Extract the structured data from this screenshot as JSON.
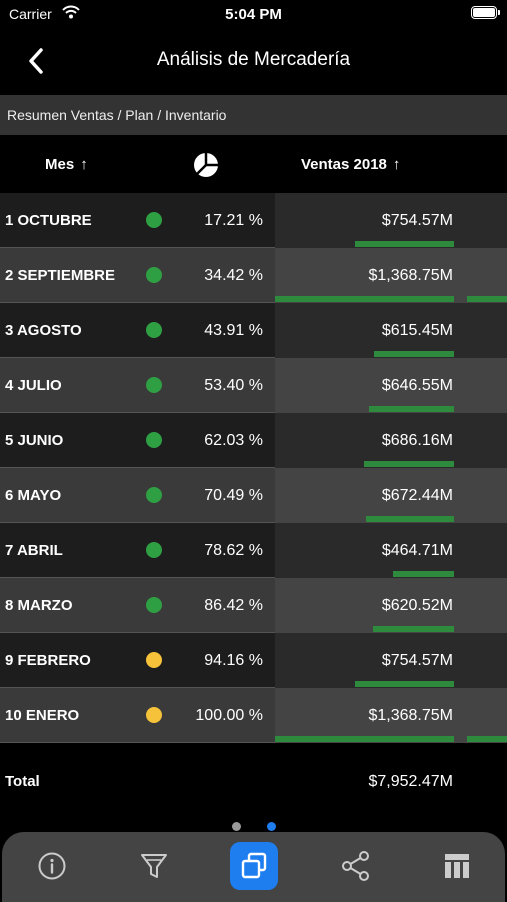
{
  "status_bar": {
    "carrier": "Carrier",
    "time": "5:04 PM"
  },
  "nav": {
    "title": "Análisis de Mercadería"
  },
  "subheader": "Resumen Ventas / Plan / Inventario",
  "columns": {
    "mes": "Mes",
    "ventas": "Ventas 2018",
    "sort_arrow": "↑"
  },
  "colors": {
    "green": "#2e8b3e",
    "dot_green": "#2ea043",
    "dot_yellow": "#f5c23a",
    "accent": "#1e7ef0"
  },
  "rows": [
    {
      "month": "1 OCTUBRE",
      "percent": "17.21 %",
      "sales": "$754.57M",
      "status": "green",
      "bar_value": 754.57
    },
    {
      "month": "2 SEPTIEMBRE",
      "percent": "34.42 %",
      "sales": "$1,368.75M",
      "status": "green",
      "bar_value": 1368.75
    },
    {
      "month": "3 AGOSTO",
      "percent": "43.91 %",
      "sales": "$615.45M",
      "status": "green",
      "bar_value": 615.45
    },
    {
      "month": "4 JULIO",
      "percent": "53.40 %",
      "sales": "$646.55M",
      "status": "green",
      "bar_value": 646.55
    },
    {
      "month": "5 JUNIO",
      "percent": "62.03 %",
      "sales": "$686.16M",
      "status": "green",
      "bar_value": 686.16
    },
    {
      "month": "6 MAYO",
      "percent": "70.49 %",
      "sales": "$672.44M",
      "status": "green",
      "bar_value": 672.44
    },
    {
      "month": "7 ABRIL",
      "percent": "78.62 %",
      "sales": "$464.71M",
      "status": "green",
      "bar_value": 464.71
    },
    {
      "month": "8 MARZO",
      "percent": "86.42 %",
      "sales": "$620.52M",
      "status": "green",
      "bar_value": 620.52
    },
    {
      "month": "9 FEBRERO",
      "percent": "94.16 %",
      "sales": "$754.57M",
      "status": "yellow",
      "bar_value": 754.57
    },
    {
      "month": "10 ENERO",
      "percent": "100.00 %",
      "sales": "$1,368.75M",
      "status": "yellow",
      "bar_value": 1368.75
    }
  ],
  "total": {
    "label": "Total",
    "value": "$7,952.47M"
  },
  "page_indicator": {
    "count": 2,
    "active": 1
  },
  "tabs": [
    {
      "icon": "info-icon",
      "active": false
    },
    {
      "icon": "filter-icon",
      "active": false
    },
    {
      "icon": "copy-icon",
      "active": true
    },
    {
      "icon": "share-icon",
      "active": false
    },
    {
      "icon": "table-icon",
      "active": false
    }
  ]
}
